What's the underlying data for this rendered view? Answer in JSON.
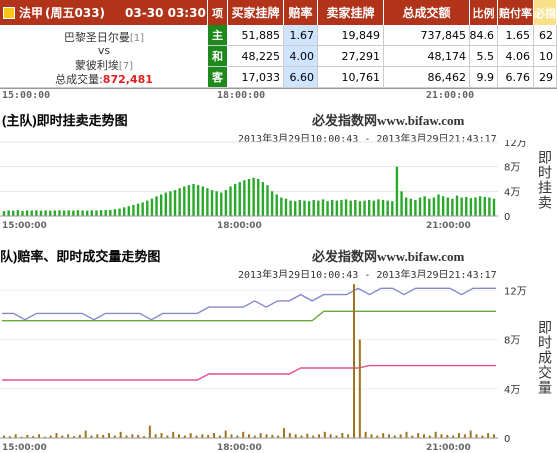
{
  "header": {
    "league": "法甲",
    "match_code": "(周五033)",
    "datetime": "03-30 03:30",
    "col_xiang": "项",
    "col_buy": "买家挂牌",
    "col_odds": "赔率",
    "col_sell": "卖家挂牌",
    "col_total": "总成交额",
    "col_ratio": "比例",
    "col_payout": "赔付率",
    "col_extra": "必指"
  },
  "match": {
    "home": "巴黎圣日尔曼",
    "home_rank": "[1]",
    "vs": "vs",
    "away": "蒙彼利埃",
    "away_rank": "[7]",
    "total_label": "总成交量:",
    "total_value": "872,481"
  },
  "rows": [
    {
      "tab": "主",
      "buy": "51,885",
      "odds": "1.67",
      "sell": "19,849",
      "total": "737,845",
      "ratio": "84.6",
      "payout": "1.65",
      "extra": "62"
    },
    {
      "tab": "和",
      "buy": "48,225",
      "odds": "4.00",
      "sell": "27,291",
      "total": "48,174",
      "ratio": "5.5",
      "payout": "4.06",
      "extra": "10"
    },
    {
      "tab": "客",
      "buy": "17,033",
      "odds": "6.60",
      "sell": "10,761",
      "total": "86,462",
      "ratio": "9.9",
      "payout": "6.76",
      "extra": "29"
    }
  ],
  "axis_top": {
    "t1": "15:00:00",
    "t2": "18:00:00",
    "t3": "21:00:00"
  },
  "panel1": {
    "title": "(主队)即时挂卖走势图",
    "brand": "必发指数网www.bifaw.com",
    "range": "2013年3月29日10:00:43 - 2013年3月29日21:43:17",
    "vlabel": "即时挂卖",
    "y_ticks": [
      "12万",
      "8万",
      "4万",
      "0"
    ],
    "x_ticks": [
      "15:00:00",
      "18:00:00",
      "21:00:00"
    ]
  },
  "panel2": {
    "title": "队)赔率、即时成交量走势图",
    "brand": "必发指数网www.bifaw.com",
    "range": "2013年3月29日10:00:43 - 2013年3月29日21:43:17",
    "vlabel": "即时成交量",
    "y_ticks": [
      "12万",
      "8万",
      "4万",
      "0"
    ],
    "x_ticks": [
      "15:00:00",
      "18:00:00",
      "21:00:00"
    ]
  },
  "chart_data": [
    {
      "type": "bar",
      "title": "(主队)即时挂卖走势图",
      "ylabel": "即时挂卖",
      "ylim": [
        0,
        120000
      ],
      "x_range": [
        "10:00:43",
        "21:43:17"
      ],
      "series": [
        {
          "values": [
            8000,
            9000,
            8500,
            9500,
            8000,
            9000,
            8800,
            9200,
            8700,
            9100,
            8600,
            9000,
            9300,
            8900,
            9100,
            8800,
            9400,
            9000,
            8700,
            9200,
            9000,
            9500,
            9800,
            10000,
            11000,
            12000,
            14000,
            16000,
            18000,
            20000,
            22000,
            25000,
            28000,
            32000,
            35000,
            38000,
            40000,
            42000,
            45000,
            48000,
            50000,
            52000,
            50000,
            48000,
            45000,
            42000,
            40000,
            38000,
            42000,
            48000,
            52000,
            55000,
            58000,
            60000,
            62000,
            60000,
            55000,
            50000,
            40000,
            35000,
            30000,
            28000,
            25000,
            24000,
            26000,
            25000,
            24000,
            26000,
            25000,
            27000,
            24000,
            26000,
            25000,
            26000,
            27000,
            25000,
            26000,
            24000,
            25000,
            26000,
            25000,
            27000,
            26000,
            25000,
            24000,
            80000,
            40000,
            30000,
            28000,
            26000,
            30000,
            32000,
            28000,
            30000,
            35000,
            32000,
            30000,
            28000,
            33000,
            30000,
            31000,
            29000,
            30000,
            32000,
            31000,
            30000,
            28000
          ]
        }
      ]
    },
    {
      "type": "line",
      "title": "队)赔率、即时成交量走势图",
      "ylabel": "即时成交量",
      "ylim": [
        0,
        120000
      ],
      "x_range": [
        "10:00:43",
        "21:43:17"
      ],
      "series": [
        {
          "values": [
            6.4,
            6.4,
            6.2,
            6.4,
            6.4,
            6.4,
            6.4,
            6.4,
            6.2,
            6.4,
            6.4,
            6.4,
            6.4,
            6.2,
            6.4,
            6.4,
            6.4,
            6.4,
            6.6,
            6.6,
            6.6,
            6.6,
            6.8,
            6.6,
            6.8,
            6.8,
            7.0,
            6.8,
            7.0,
            7.0,
            7.0,
            7.2,
            7.0,
            7.2,
            7.2,
            7.0,
            7.2,
            7.2,
            7.2,
            7.2,
            7.0,
            7.2,
            7.2,
            7.2
          ]
        },
        {
          "values": [
            4.0,
            4.0,
            4.0,
            4.0,
            4.0,
            4.0,
            4.0,
            4.0,
            4.0,
            4.0,
            4.0,
            4.0,
            4.0,
            4.0,
            4.0,
            4.0,
            4.0,
            4.0,
            4.0,
            4.0,
            4.0,
            4.0,
            4.0,
            4.0,
            4.0,
            4.0,
            4.0,
            4.0,
            4.2,
            4.2,
            4.2,
            4.2,
            4.2,
            4.2,
            4.2,
            4.2,
            4.2,
            4.2,
            4.2,
            4.2,
            4.2,
            4.2,
            4.2,
            4.2
          ]
        },
        {
          "values": [
            1.55,
            1.55,
            1.55,
            1.55,
            1.55,
            1.55,
            1.55,
            1.55,
            1.55,
            1.55,
            1.55,
            1.55,
            1.55,
            1.55,
            1.55,
            1.55,
            1.55,
            1.55,
            1.6,
            1.6,
            1.6,
            1.6,
            1.6,
            1.6,
            1.6,
            1.6,
            1.65,
            1.65,
            1.65,
            1.65,
            1.65,
            1.65,
            1.67,
            1.67,
            1.67,
            1.67,
            1.67,
            1.67,
            1.67,
            1.67,
            1.67,
            1.67,
            1.67,
            1.67
          ]
        },
        {
          "values": [
            2000,
            1500,
            3000,
            1000,
            2500,
            1500,
            3000,
            1000,
            2000,
            4000,
            2000,
            3000,
            1500,
            2500,
            6000,
            2000,
            3000,
            2500,
            4000,
            2000,
            5000,
            2000,
            3000,
            2500,
            1500,
            10000,
            3000,
            4000,
            2000,
            5000,
            3000,
            2000,
            4000,
            2000,
            3000,
            2500,
            4000,
            2000,
            6000,
            3000,
            2000,
            5000,
            3000,
            2000,
            4000,
            3000,
            2500,
            2000,
            8000,
            4000,
            3000,
            2000,
            3500,
            2000,
            3000,
            5000,
            3000,
            2000,
            4000,
            3000,
            125000,
            80000,
            5000,
            3000,
            2000,
            4000,
            3000,
            2000,
            3000,
            5000,
            2000,
            4000,
            3000,
            2000,
            5000,
            3000,
            2500,
            2000,
            4000,
            3000,
            6000,
            3000,
            2000,
            4000,
            3000
          ]
        }
      ]
    }
  ]
}
